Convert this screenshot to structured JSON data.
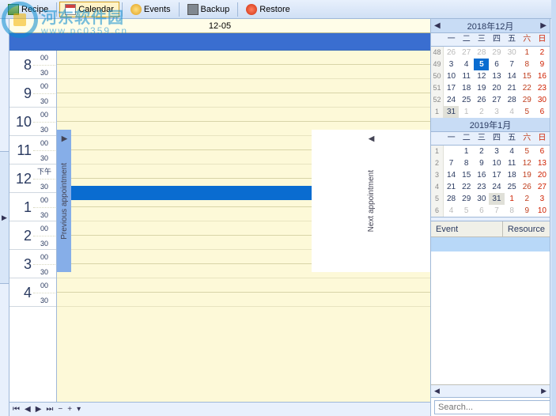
{
  "toolbar": {
    "recipe": "Recipe",
    "calendar": "Calendar",
    "events": "Events",
    "backup": "Backup",
    "restore": "Restore"
  },
  "date_header": "12-05",
  "hours": [
    {
      "h": "8",
      "m1": "00",
      "m2": "30"
    },
    {
      "h": "9",
      "m1": "00",
      "m2": "30"
    },
    {
      "h": "10",
      "m1": "00",
      "m2": "30"
    },
    {
      "h": "11",
      "m1": "00",
      "m2": "30"
    },
    {
      "h": "12",
      "m1": "下午",
      "m2": "30"
    },
    {
      "h": "1",
      "m1": "00",
      "m2": "30"
    },
    {
      "h": "2",
      "m1": "00",
      "m2": "30"
    },
    {
      "h": "3",
      "m1": "00",
      "m2": "30"
    },
    {
      "h": "4",
      "m1": "00",
      "m2": "30"
    }
  ],
  "prev_appt": "Previous appointment",
  "next_appt": "Next appointment",
  "calendars": [
    {
      "title": "2018年12月",
      "dow": [
        "一",
        "二",
        "三",
        "四",
        "五",
        "六",
        "日"
      ],
      "weeks": [
        "48",
        "49",
        "50",
        "51",
        "52",
        "1"
      ],
      "rows": [
        [
          {
            "d": "26",
            "o": 1
          },
          {
            "d": "27",
            "o": 1
          },
          {
            "d": "28",
            "o": 1
          },
          {
            "d": "29",
            "o": 1
          },
          {
            "d": "30",
            "o": 1
          },
          {
            "d": "1",
            "s": 1
          },
          {
            "d": "2",
            "u": 1
          }
        ],
        [
          {
            "d": "3"
          },
          {
            "d": "4"
          },
          {
            "d": "5",
            "t": 1
          },
          {
            "d": "6"
          },
          {
            "d": "7"
          },
          {
            "d": "8",
            "s": 1
          },
          {
            "d": "9",
            "u": 1
          }
        ],
        [
          {
            "d": "10"
          },
          {
            "d": "11"
          },
          {
            "d": "12"
          },
          {
            "d": "13"
          },
          {
            "d": "14"
          },
          {
            "d": "15",
            "s": 1
          },
          {
            "d": "16",
            "u": 1
          }
        ],
        [
          {
            "d": "17"
          },
          {
            "d": "18"
          },
          {
            "d": "19"
          },
          {
            "d": "20"
          },
          {
            "d": "21"
          },
          {
            "d": "22",
            "s": 1
          },
          {
            "d": "23",
            "u": 1
          }
        ],
        [
          {
            "d": "24"
          },
          {
            "d": "25"
          },
          {
            "d": "26"
          },
          {
            "d": "27"
          },
          {
            "d": "28"
          },
          {
            "d": "29",
            "s": 1
          },
          {
            "d": "30",
            "u": 1
          }
        ],
        [
          {
            "d": "31",
            "h": 1
          },
          {
            "d": "1",
            "o": 1
          },
          {
            "d": "2",
            "o": 1
          },
          {
            "d": "3",
            "o": 1
          },
          {
            "d": "4",
            "o": 1
          },
          {
            "d": "5",
            "o": 1,
            "s": 1
          },
          {
            "d": "6",
            "o": 1,
            "u": 1
          }
        ]
      ]
    },
    {
      "title": "2019年1月",
      "dow": [
        "一",
        "二",
        "三",
        "四",
        "五",
        "六",
        "日"
      ],
      "weeks": [
        "1",
        "2",
        "3",
        "4",
        "5",
        "6"
      ],
      "rows": [
        [
          {
            "d": "",
            "o": 1
          },
          {
            "d": "1"
          },
          {
            "d": "2"
          },
          {
            "d": "3"
          },
          {
            "d": "4"
          },
          {
            "d": "5",
            "s": 1
          },
          {
            "d": "6",
            "u": 1
          }
        ],
        [
          {
            "d": "7"
          },
          {
            "d": "8"
          },
          {
            "d": "9"
          },
          {
            "d": "10"
          },
          {
            "d": "11"
          },
          {
            "d": "12",
            "s": 1
          },
          {
            "d": "13",
            "u": 1
          }
        ],
        [
          {
            "d": "14"
          },
          {
            "d": "15"
          },
          {
            "d": "16"
          },
          {
            "d": "17"
          },
          {
            "d": "18"
          },
          {
            "d": "19",
            "s": 1
          },
          {
            "d": "20",
            "u": 1
          }
        ],
        [
          {
            "d": "21"
          },
          {
            "d": "22"
          },
          {
            "d": "23"
          },
          {
            "d": "24"
          },
          {
            "d": "25"
          },
          {
            "d": "26",
            "s": 1
          },
          {
            "d": "27",
            "u": 1
          }
        ],
        [
          {
            "d": "28"
          },
          {
            "d": "29"
          },
          {
            "d": "30"
          },
          {
            "d": "31",
            "h": 1
          },
          {
            "d": "1",
            "o": 1,
            "u": 1
          },
          {
            "d": "2",
            "o": 1,
            "s": 1
          },
          {
            "d": "3",
            "o": 1,
            "u": 1
          }
        ],
        [
          {
            "d": "4",
            "o": 1
          },
          {
            "d": "5",
            "o": 1
          },
          {
            "d": "6",
            "o": 1
          },
          {
            "d": "7",
            "o": 1
          },
          {
            "d": "8",
            "o": 1
          },
          {
            "d": "9",
            "o": 1,
            "s": 1
          },
          {
            "d": "10",
            "o": 1,
            "u": 1
          }
        ]
      ]
    }
  ],
  "event_list": {
    "col_event": "Event",
    "col_resource": "Resource"
  },
  "search": {
    "placeholder": "Search..."
  },
  "watermark": {
    "text": "河东软件园",
    "sub": "www.pc0359.cn"
  }
}
